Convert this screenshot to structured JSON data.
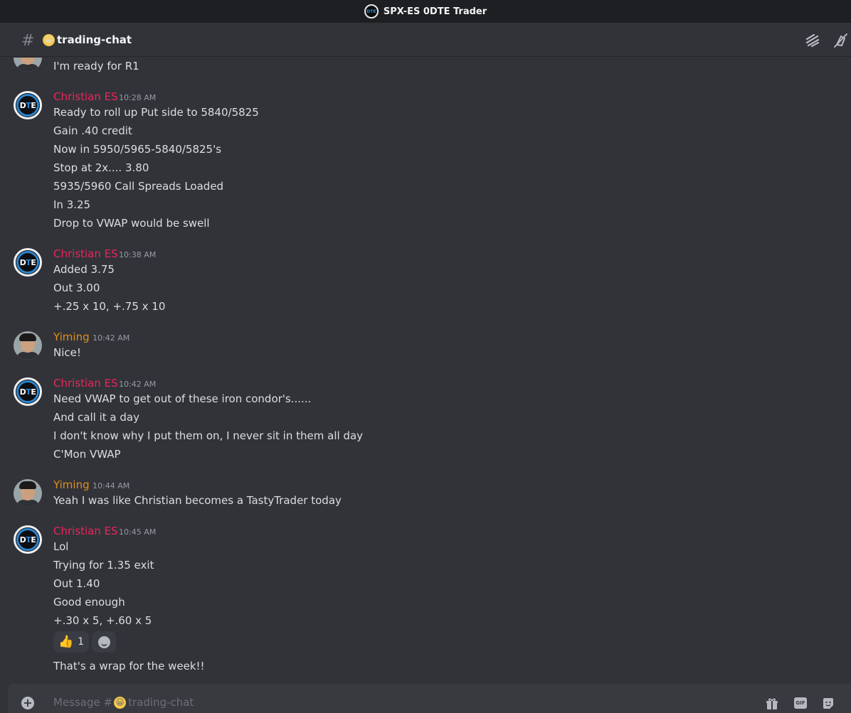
{
  "window": {
    "title": "SPX-ES 0DTE Trader",
    "server_icon": "DTE"
  },
  "channel": {
    "name": "trading-chat",
    "emoji": "😀",
    "icons": [
      "threads-icon",
      "notifications-off-icon"
    ]
  },
  "messages": {
    "first": {
      "lines": [
        "I'm ready for R1"
      ]
    },
    "m1": {
      "author": "Christian ES",
      "time": "10:28 AM",
      "lines": [
        "Ready to roll up Put side to 5840/5825",
        "Gain .40 credit",
        "Now in 5950/5965-5840/5825's",
        "Stop at 2x....  3.80",
        "5935/5960 Call Spreads Loaded",
        "In 3.25",
        "Drop to VWAP would be swell"
      ]
    },
    "m2": {
      "author": "Christian ES",
      "time": "10:38 AM",
      "lines": [
        "Added 3.75",
        "Out 3.00",
        "+.25 x 10,  +.75 x 10"
      ]
    },
    "m3": {
      "author": "Yiming",
      "time": "10:42 AM",
      "lines": [
        "Nice!"
      ]
    },
    "m4": {
      "author": "Christian ES",
      "time": "10:42 AM",
      "lines": [
        "Need VWAP to get out of these iron condor's......",
        "And call it a day",
        "I don't know why I put them on, I never sit in them all day",
        "C'Mon VWAP"
      ]
    },
    "m5": {
      "author": "Yiming",
      "time": "10:44 AM",
      "lines": [
        "Yeah I was like Christian becomes a TastyTrader today"
      ]
    },
    "m6": {
      "author": "Christian ES",
      "time": "10:45 AM",
      "lines": [
        "Lol",
        "Trying for 1.35 exit",
        "Out 1.40",
        "Good enough",
        "+.30 x 5,  +.60 x 5"
      ],
      "reaction": {
        "emoji": "👍",
        "count": "1"
      },
      "after": "That's a wrap for the week!!"
    }
  },
  "composer": {
    "placeholder_prefix": "Message #",
    "placeholder_channel": "trading-chat",
    "emoji": "😀",
    "gif_label": "GIF"
  },
  "colors": {
    "red_author": "#e8265a",
    "gold_author": "#dd8f1e",
    "background": "#323339"
  }
}
